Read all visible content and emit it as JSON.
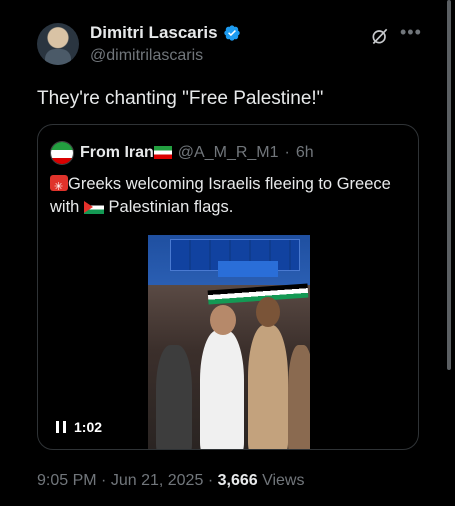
{
  "author": {
    "name": "Dimitri Lascaris",
    "handle": "@dimitrilascaris"
  },
  "icons": [
    "verified-badge-icon",
    "grok-icon",
    "more-icon"
  ],
  "tweet": {
    "text": "They're chanting  \"Free Palestine!\""
  },
  "quote": {
    "name": "From Iran",
    "handle": "@A_M_R_M1",
    "separator": "·",
    "time": "6h",
    "text_part1": "Greeks welcoming Israelis fleeing to Greece with",
    "text_part2": "Palestinian flags."
  },
  "video": {
    "duration": "1:02"
  },
  "footer": {
    "time": "9:05 PM",
    "date": "Jun 21, 2025",
    "dot": "·",
    "views_count": "3,666",
    "views_label": "Views"
  },
  "colors": {
    "background": "#000000",
    "text": "#e7e9ea",
    "muted": "#71767b",
    "verified": "#1d9bf0",
    "border": "#2f3336"
  }
}
